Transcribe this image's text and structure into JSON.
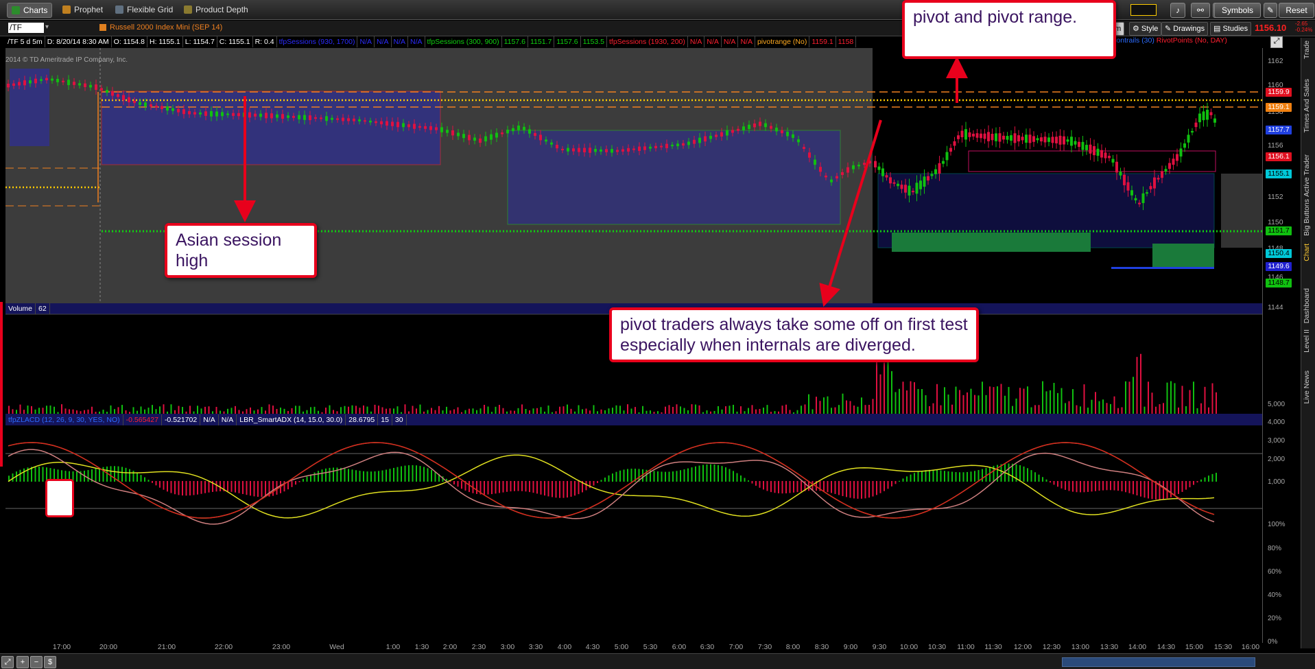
{
  "tabs": [
    "Charts",
    "Prophet",
    "Flexible Grid",
    "Product Depth"
  ],
  "topright": {
    "symbols": "Symbols",
    "reset": "Reset"
  },
  "toolbar": {
    "symbol": "/TF",
    "description": "Russell 2000 Index Mini (SEP 14)",
    "period": "5m",
    "style": "Style",
    "drawings": "Drawings",
    "studies": "Studies",
    "last_price": "1156.10",
    "change1": "-2.65",
    "change2": "-0.24%"
  },
  "status": {
    "interval": "/TF 5 d 5m",
    "date": "D: 8/20/14 8:30 AM",
    "open": "O: 1154.8",
    "high": "H: 1155.1",
    "low": "L: 1154.7",
    "close": "C: 1155.1",
    "range": "R: 0.4",
    "sess1": "tfpSessions (930, 1700)",
    "na1": "N/A",
    "na2": "N/A",
    "na3": "N/A",
    "na4": "N/A",
    "sess2": "tfpSessions (300, 900)",
    "v1": "1157.6",
    "v2": "1151.7",
    "v3": "1157.6",
    "v4": "1153.5",
    "sess3": "tfpSessions (1930, 200)",
    "na5": "N/A",
    "na6": "N/A",
    "na7": "N/A",
    "na8": "N/A",
    "pivot": "pivotrange (No)",
    "pv1": "1159.1",
    "pv2": "1158",
    "contrails": "oContrails (30)",
    "pivotpoints": "RivotPoints (No, DAY)"
  },
  "copyright": "2014 © TD Ameritrade IP Company, Inc.",
  "price_axis": [
    "1162",
    "1160",
    "1158",
    "1156",
    "1154",
    "1152",
    "1150",
    "1148",
    "1146",
    "1144"
  ],
  "price_tags": [
    {
      "v": "1159.9",
      "c": "#e01020"
    },
    {
      "v": "1159.1",
      "c": "#f08010"
    },
    {
      "v": "1157.7",
      "c": "#2040e0"
    },
    {
      "v": "1156.1",
      "c": "#e01020"
    },
    {
      "v": "1155.1",
      "c": "#00c8d8"
    },
    {
      "v": "1151.7",
      "c": "#10c010"
    },
    {
      "v": "1150.4",
      "c": "#00c8d8"
    },
    {
      "v": "1149.6",
      "c": "#2020d0"
    },
    {
      "v": "1148.7",
      "c": "#10c010"
    }
  ],
  "volume": {
    "label": "Volume",
    "value": "62",
    "axis": [
      "5,000",
      "4,000",
      "3,000",
      "2,000",
      "1,000"
    ]
  },
  "osc": {
    "name": "tfpZLACD (12, 26, 9, 30, YES, NO)",
    "v1": "-0.565427",
    "v2": "-0.521702",
    "na1": "N/A",
    "na2": "N/A",
    "adx": "LBR_SmartADX (14, 15.0, 30.0)",
    "adxv": "28.6795",
    "p1": "15",
    "p2": "30",
    "axis": [
      "100%",
      "80%",
      "60%",
      "40%",
      "20%",
      "0%"
    ]
  },
  "time_axis": [
    "17:00",
    "20:00",
    "21:00",
    "22:00",
    "23:00",
    "Wed",
    "1:00",
    "1:30",
    "2:00",
    "2:30",
    "3:00",
    "3:30",
    "4:00",
    "4:30",
    "5:00",
    "5:30",
    "6:00",
    "6:30",
    "7:00",
    "7:30",
    "8:00",
    "8:30",
    "9:00",
    "9:30",
    "10:00",
    "10:30",
    "11:00",
    "11:30",
    "12:00",
    "12:30",
    "13:00",
    "13:30",
    "14:00",
    "14:30",
    "15:00",
    "15:30",
    "16:00"
  ],
  "sidebar": [
    "Trade",
    "Times And Sales",
    "Active Trader",
    "Big Buttons",
    "Chart",
    "Dashboard",
    "Level II",
    "Live News"
  ],
  "callouts": {
    "asian": "Asian session high",
    "pivot": "pivot and pivot range.",
    "traders": "pivot traders always take some off on first test especially when internals are diverged."
  },
  "colors": {
    "up": "#10c010",
    "down": "#e01040",
    "session_box": "#2a2aa0",
    "pivot": "#ffcc00"
  }
}
